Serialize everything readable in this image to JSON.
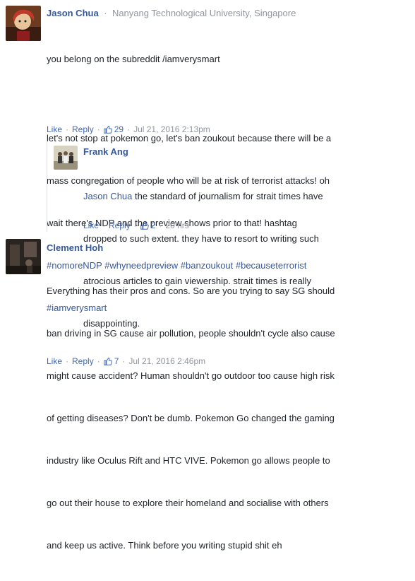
{
  "comments": [
    {
      "author": "Jason Chua",
      "separator": "·",
      "affiliation": "Nanyang Technological University, Singapore",
      "lines": [
        "you belong on the subreddit /iamverysmart",
        "",
        "let's not stop at pokemon go, let's ban zoukout because there will be a",
        "mass congregation of people who will be at risk of terrorist attacks! oh",
        "wait there's NDP and the preview shows prior to that! hashtag"
      ],
      "hashtags_line1": "#nomoreNDP #whyneedpreview #banzoukout #becauseterrorist",
      "hashtags_line2": "#iamverysmart",
      "like_label": "Like",
      "reply_label": "Reply",
      "likes": "29",
      "timestamp": "Jul 21, 2016 2:13pm",
      "avatar_icon": "cartoon-avatar-icon"
    },
    {
      "author": "Frank Ang",
      "mention": "Jason Chua",
      "text_after_mention": " the standard of journalism for strait times have",
      "lines": [
        "dropped to such extent. they have to resort to writing such",
        "atrocious articles to gain viewership. strait times is really",
        "disappointing."
      ],
      "like_label": "Like",
      "reply_label": "Reply",
      "likes": "2",
      "timestamp": "20 hrs",
      "avatar_icon": "group-photo-avatar-icon"
    },
    {
      "author": "Clement Hoh",
      "lines": [
        "Everything has their pros and cons. So are you trying to say SG should",
        "ban driving in SG cause air pollution, people shouldn't cycle also cause",
        "might cause accident? Human shouldn't go outdoor too cause high risk",
        "of getting diseases? Don't be dumb. Pokemon Go changed the gaming",
        "industry like Oculus Rift and HTC VIVE. Pokemon go allows people to",
        "go out their house to explore their homeland and socialise with others",
        "and keep us active. Think before you writing stupid shit eh"
      ],
      "like_label": "Like",
      "reply_label": "Reply",
      "likes": "7",
      "timestamp": "Jul 21, 2016 2:46pm",
      "avatar_icon": "dark-room-avatar-icon"
    }
  ],
  "ui": {
    "dot": "·",
    "link_color": "#365899",
    "action_color": "#4267b2",
    "meta_color": "#90949c"
  }
}
